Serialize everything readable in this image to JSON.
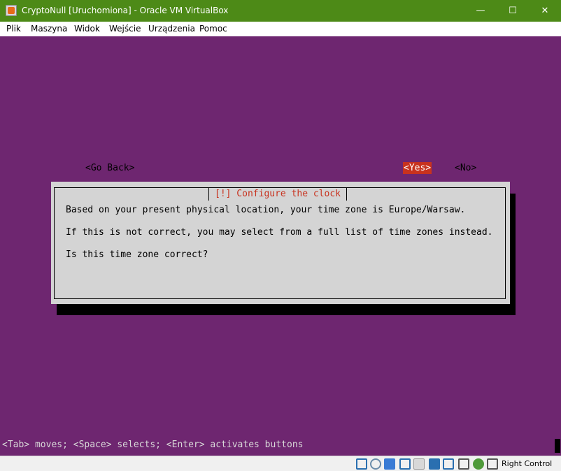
{
  "window": {
    "title": "CryptoNull [Uruchomiona] - Oracle VM VirtualBox",
    "controls": {
      "minimize": "—",
      "maximize": "☐",
      "close": "✕"
    }
  },
  "menu": {
    "items": [
      {
        "label": "Plik"
      },
      {
        "label": "Maszyna"
      },
      {
        "label": "Widok"
      },
      {
        "label": "Wejście"
      },
      {
        "label": "Urządzenia"
      },
      {
        "label": "Pomoc"
      }
    ]
  },
  "colors": {
    "titlebar": "#4d8a17",
    "screen_background": "#6e2670",
    "dialog_background": "#d4d4d4",
    "accent_red": "#c8321e"
  },
  "dialog": {
    "title": "[!] Configure the clock",
    "lines": [
      "Based on your present physical location, your time zone is Europe/Warsaw.",
      "If this is not correct, you may select from a full list of time zones instead.",
      "Is this time zone correct?"
    ],
    "buttons": {
      "go_back": "<Go Back>",
      "yes": "<Yes>",
      "no": "<No>"
    },
    "selected_button": "yes"
  },
  "terminal_status": "<Tab> moves; <Space> selects; <Enter> activates buttons",
  "statusbar": {
    "icons": [
      "hard-disk-icon",
      "optical-disc-icon",
      "audio-icon",
      "network-icon",
      "usb-icon",
      "shared-folder-icon",
      "display-icon",
      "video-capture-icon",
      "cpu-icon",
      "mouse-integration-icon",
      "keyboard-capture-icon"
    ],
    "host_key": "Right Control"
  }
}
